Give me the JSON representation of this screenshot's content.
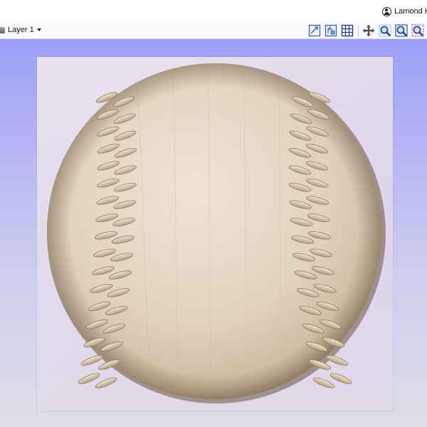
{
  "header": {
    "user_name": "Lamond H"
  },
  "toolbar": {
    "layer_label": "Layer 1",
    "tools": [
      "view-fit-icon",
      "view-isometric-icon",
      "grid-icon",
      "pan-icon",
      "zoom-icon",
      "zoom-extents-icon",
      "zoom-selection-icon"
    ]
  },
  "colors": {
    "viewport_top": "#9d9ef8",
    "viewport_bottom": "#dedee8",
    "wood_light": "#e9dccb",
    "wood_dark": "#8a7560",
    "stitch": "#d9c7ae"
  }
}
